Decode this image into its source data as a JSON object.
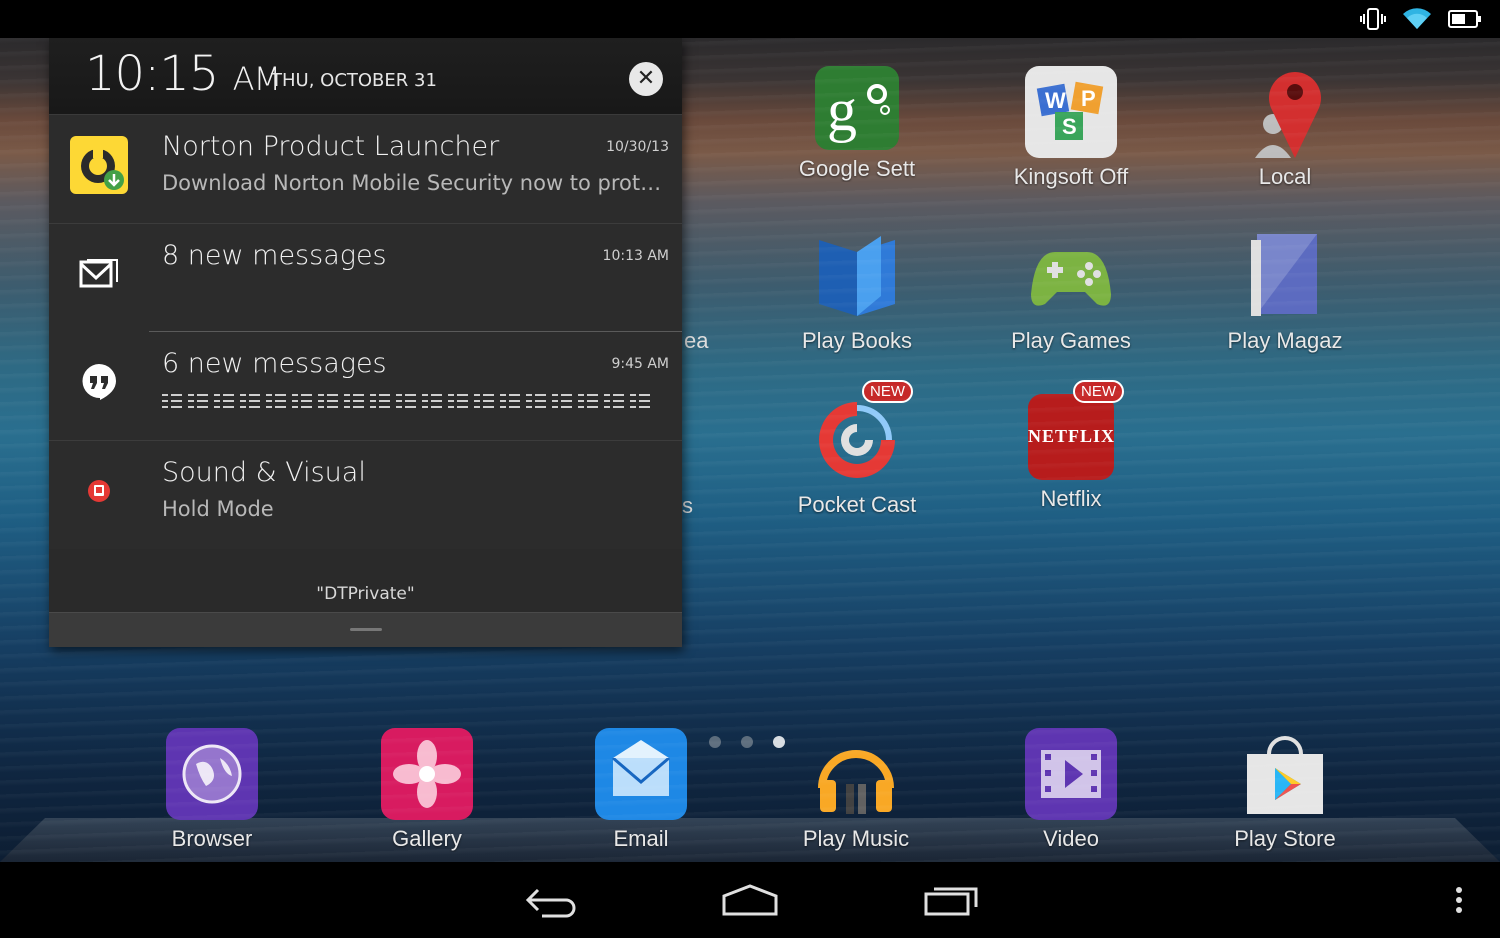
{
  "status_bar": {
    "icons": [
      "vibrate-icon",
      "wifi-icon",
      "battery-icon"
    ]
  },
  "shade": {
    "time": "10:15",
    "ampm": "AM",
    "date": "THU, OCTOBER 31",
    "clear_symbol": "✕",
    "notifications": [
      {
        "title": "Norton Product Launcher",
        "text": "Download Norton Mobile Security now to prote…",
        "time": "10/30/13",
        "icon": "norton-icon"
      },
      {
        "title": "8 new messages",
        "text": "",
        "time": "10:13 AM",
        "icon": "gmail-icon"
      },
      {
        "title": "6 new messages",
        "text": "",
        "time": "9:45 AM",
        "icon": "hangouts-icon"
      },
      {
        "title": "Sound & Visual",
        "text": "Hold Mode",
        "time": "",
        "icon": "sound-visual-icon"
      }
    ],
    "network_name": "\"DTPrivate\""
  },
  "home": {
    "partial_labels": {
      "row2": "ea",
      "row3": "s"
    },
    "apps": [
      {
        "label": "Google Sett",
        "icon": "google-settings-icon",
        "badge": ""
      },
      {
        "label": "Kingsoft Off",
        "icon": "kingsoft-office-icon",
        "badge": ""
      },
      {
        "label": "Local",
        "icon": "local-icon",
        "badge": ""
      },
      {
        "label": "Play Books",
        "icon": "play-books-icon",
        "badge": ""
      },
      {
        "label": "Play Games",
        "icon": "play-games-icon",
        "badge": ""
      },
      {
        "label": "Play Magaz",
        "icon": "play-magazines-icon",
        "badge": ""
      },
      {
        "label": "Pocket Cast",
        "icon": "pocket-casts-icon",
        "badge": "NEW"
      },
      {
        "label": "Netflix",
        "icon": "netflix-icon",
        "badge": "NEW"
      }
    ],
    "netflix_logo_text": "NETFLIX",
    "pages": 3,
    "active_page": 3,
    "dock": [
      {
        "label": "Browser",
        "icon": "browser-icon"
      },
      {
        "label": "Gallery",
        "icon": "gallery-icon"
      },
      {
        "label": "Email",
        "icon": "email-icon"
      },
      {
        "label": "Play Music",
        "icon": "play-music-icon"
      },
      {
        "label": "Video",
        "icon": "video-icon"
      },
      {
        "label": "Play Store",
        "icon": "play-store-icon"
      }
    ]
  },
  "nav_bar": {
    "buttons": [
      "back-icon",
      "home-icon",
      "recents-icon",
      "menu-icon"
    ]
  }
}
